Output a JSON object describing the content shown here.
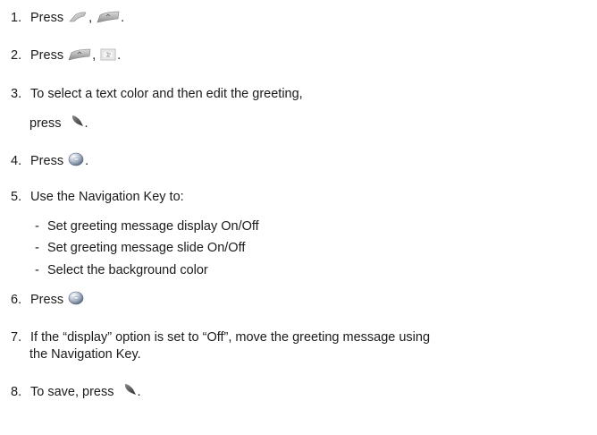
{
  "steps": [
    {
      "num": "1.",
      "text": "Press",
      "sep": ",",
      "end": "."
    },
    {
      "num": "2.",
      "text": "Press",
      "sep": ",",
      "end": "."
    },
    {
      "num": "3.",
      "text": "To select a text color and then edit the greeting,",
      "text2": "press",
      "end": "."
    },
    {
      "num": "4.",
      "text": "Press",
      "end": "."
    },
    {
      "num": "5.",
      "text": "Use the Navigation Key to:"
    },
    {
      "num": "6.",
      "text": "Press"
    },
    {
      "num": "7.",
      "text": "If the “display” option is set to “Off”, move the greeting message using",
      "text2": "the Navigation Key."
    },
    {
      "num": "8.",
      "text": "To save, press",
      "end": "."
    }
  ],
  "sub_items": [
    {
      "dash": "-",
      "text": "Set greeting message display On/Off"
    },
    {
      "dash": "-",
      "text": "Set greeting message slide On/Off"
    },
    {
      "dash": "-",
      "text": "Select the background color"
    }
  ],
  "icons": {
    "left_soft_key": "left-soft-key-icon",
    "menu_key": "menu-key-icon",
    "display_menu": "display-menu-icon",
    "right_soft_key": "right-soft-key-icon",
    "ok_key": "ok-key-icon"
  }
}
